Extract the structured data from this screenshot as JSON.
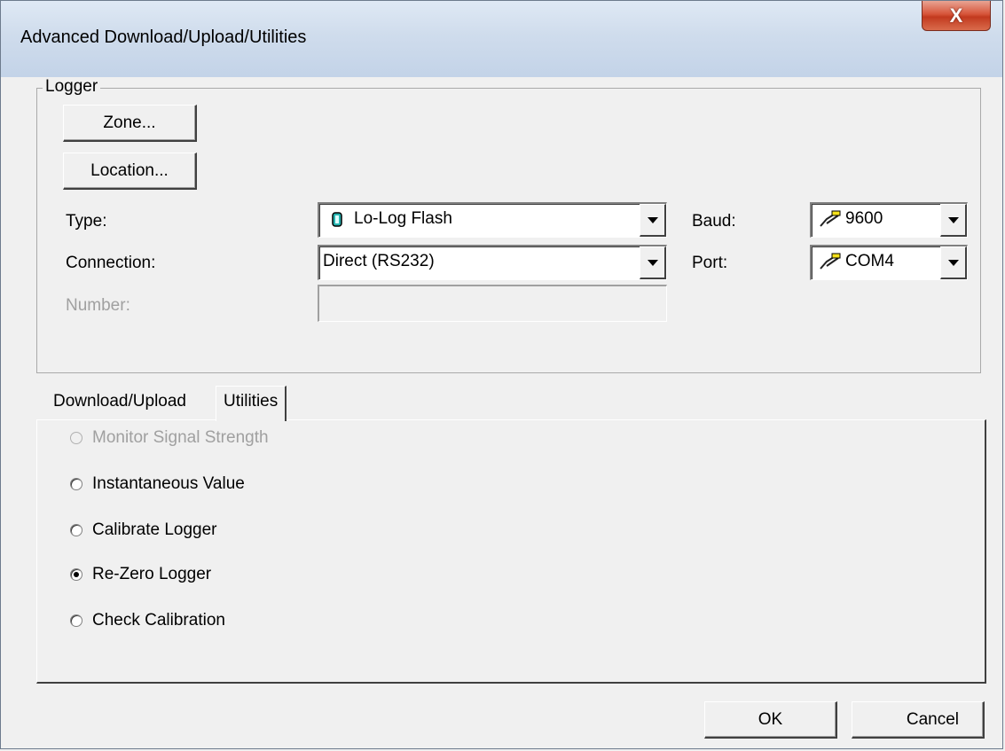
{
  "window": {
    "title": "Advanced Download/Upload/Utilities",
    "close_label": "X"
  },
  "logger": {
    "legend": "Logger",
    "zone_button": "Zone...",
    "location_button": "Location...",
    "type_label": "Type:",
    "type_value": "Lo-Log Flash",
    "connection_label": "Connection:",
    "connection_value": "Direct (RS232)",
    "number_label": "Number:",
    "number_value": "",
    "baud_label": "Baud:",
    "baud_value": "9600",
    "port_label": "Port:",
    "port_value": "COM4"
  },
  "tabs": [
    {
      "label": "Download/Upload",
      "active": false
    },
    {
      "label": "Utilities",
      "active": true
    }
  ],
  "utilities": [
    {
      "label": "Monitor Signal Strength",
      "enabled": false,
      "selected": false
    },
    {
      "label": "Instantaneous Value",
      "enabled": true,
      "selected": false
    },
    {
      "label": "Calibrate Logger",
      "enabled": true,
      "selected": false
    },
    {
      "label": "Re-Zero Logger",
      "enabled": true,
      "selected": true
    },
    {
      "label": "Check Calibration",
      "enabled": true,
      "selected": false
    }
  ],
  "footer": {
    "ok_label": "OK",
    "cancel_label": "Cancel"
  },
  "colors": {
    "title_bar": "#cfdcec",
    "close_button": "#c9432a",
    "dialog_bg": "#f0f0f0",
    "disabled_text": "#a0a0a0"
  },
  "icons": {
    "type_icon": "logger-device-icon",
    "baud_icon": "serial-cable-icon",
    "port_icon": "serial-cable-icon"
  }
}
